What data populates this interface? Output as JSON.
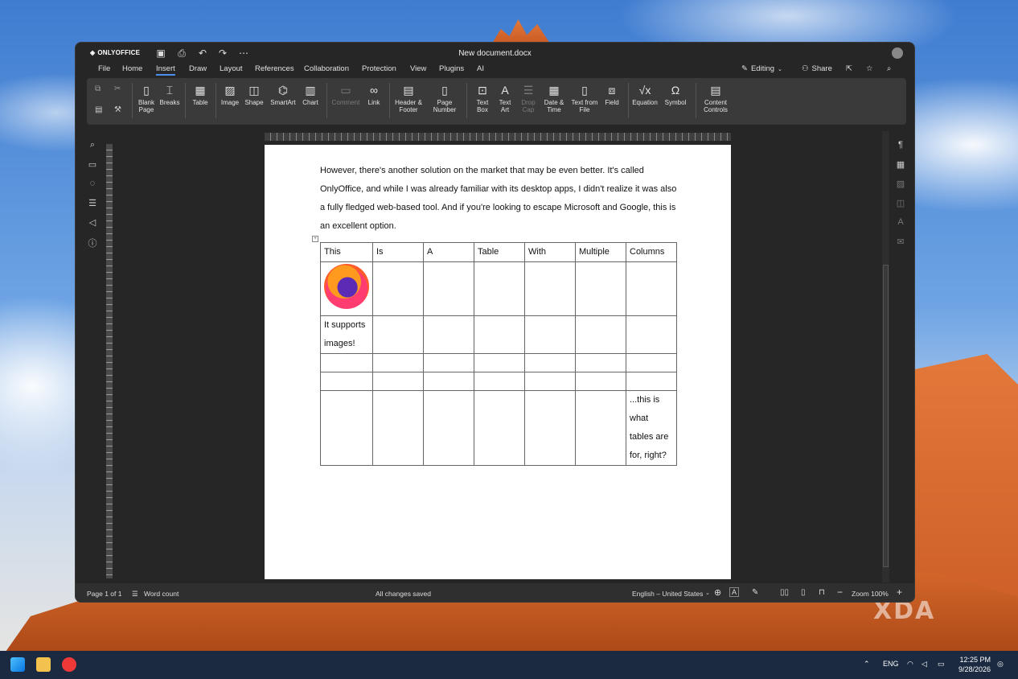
{
  "app": {
    "brand": "ONLYOFFICE",
    "document_title": "New document.docx"
  },
  "quick_access": [
    {
      "name": "save-icon",
      "glyph": "💾"
    },
    {
      "name": "print-icon",
      "glyph": "⎙"
    },
    {
      "name": "undo-icon",
      "glyph": "↶"
    },
    {
      "name": "redo-icon",
      "glyph": "↷"
    },
    {
      "name": "more-icon",
      "glyph": "⋯"
    }
  ],
  "menu": [
    "File",
    "Home",
    "Insert",
    "Draw",
    "Layout",
    "References",
    "Collaboration",
    "Protection",
    "View",
    "Plugins",
    "AI"
  ],
  "menu_active": "Insert",
  "header_right": {
    "editing": "Editing",
    "share": "Share"
  },
  "toolbar": {
    "blank_page": "Blank\nPage",
    "breaks": "Breaks",
    "table": "Table",
    "image": "Image",
    "shape": "Shape",
    "smartart": "SmartArt",
    "chart": "Chart",
    "comment": "Comment",
    "link": "Link",
    "header_footer": "Header &\nFooter",
    "page_number": "Page\nNumber",
    "text_box": "Text\nBox",
    "text_art": "Text\nArt",
    "drop_cap": "Drop\nCap",
    "date_time": "Date &\nTime",
    "text_from_file": "Text from\nFile",
    "field": "Field",
    "equation": "Equation",
    "symbol": "Symbol",
    "content_controls": "Content\nControls"
  },
  "document": {
    "paragraph": "However, there's another solution on the market that may be even better. It's called OnlyOffice, and while I was already familiar with its desktop apps, I didn't realize it was also a fully fledged web-based tool. And if you're looking to escape Microsoft and Google, this is an excellent option.",
    "table_header": [
      "This",
      "Is",
      "A",
      "Table",
      "With",
      "Multiple",
      "Columns"
    ],
    "image_caption": "It supports images!",
    "last_cell": "...this is what tables are for, right?"
  },
  "status": {
    "page": "Page 1 of 1",
    "word_count": "Word count",
    "saved": "All changes saved",
    "language": "English – United States",
    "zoom": "Zoom 100%"
  },
  "taskbar": {
    "lang": "ENG",
    "time": "12:25 PM",
    "date": "9/28/2026"
  },
  "watermark": "XDA"
}
